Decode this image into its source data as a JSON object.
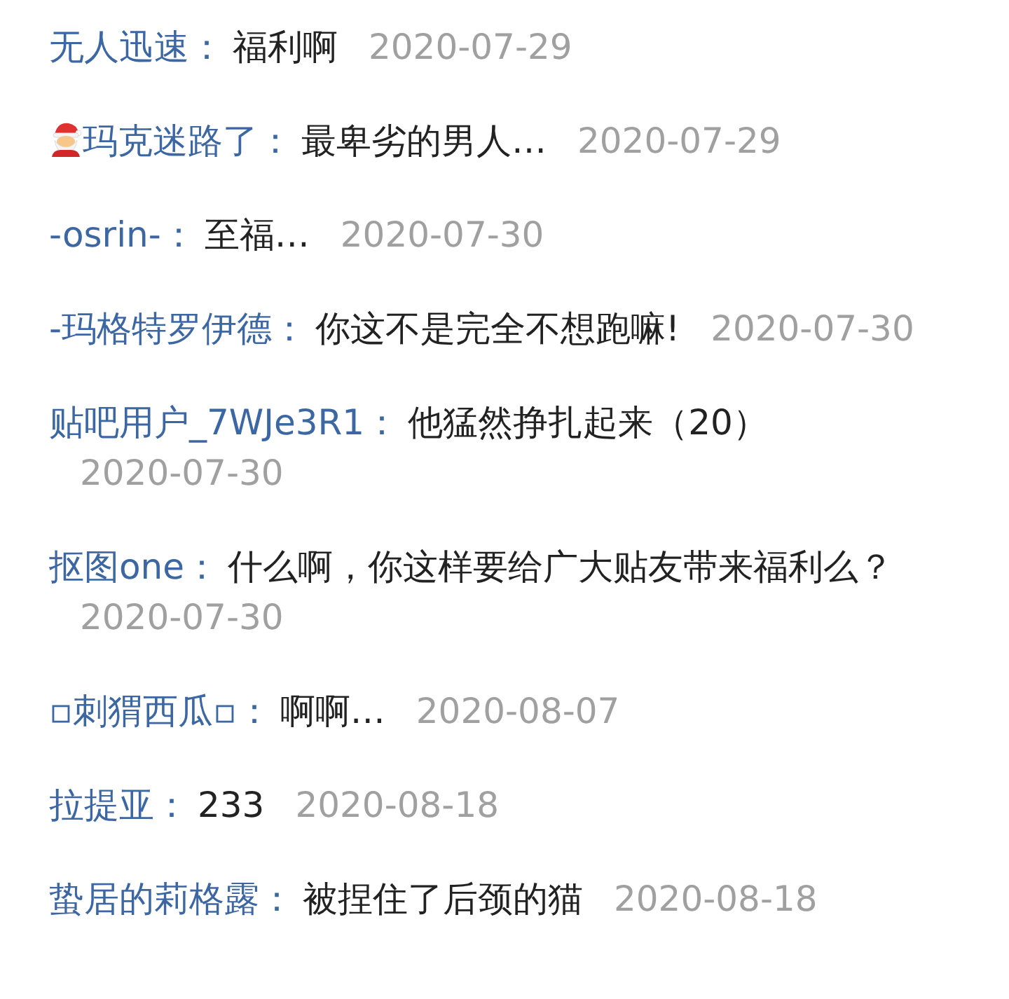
{
  "comments": [
    {
      "kind": "plain",
      "user": "无人迅速：",
      "text": "福利啊",
      "date": "2020-07-29"
    },
    {
      "kind": "figure",
      "user": "玛克迷路了：",
      "text": "最卑劣的男人…",
      "date": "2020-07-29"
    },
    {
      "kind": "plain",
      "user": "-osrin-：",
      "text": "至福…",
      "date": "2020-07-30"
    },
    {
      "kind": "plain",
      "user": "-玛格特罗伊德：",
      "text": "你这不是完全不想跑嘛!",
      "date": "2020-07-30"
    },
    {
      "kind": "plain",
      "user": "贴吧用户_7WJe3R1：",
      "text": "他猛然挣扎起来（20）",
      "date": "2020-07-30"
    },
    {
      "kind": "plain",
      "user": "抠图one：",
      "text": "什么啊，你这样要给广大贴友带来福利么？",
      "date": "2020-07-30"
    },
    {
      "kind": "plain",
      "user": "▫刺猬西瓜▫：",
      "text": "啊啊…",
      "date": "2020-08-07"
    },
    {
      "kind": "plain",
      "user": "拉提亚：",
      "text": "233",
      "date": "2020-08-18"
    },
    {
      "kind": "plain",
      "user": "蛰居的莉格露：",
      "text": "被捏住了后颈的猫",
      "date": "2020-08-18"
    }
  ]
}
